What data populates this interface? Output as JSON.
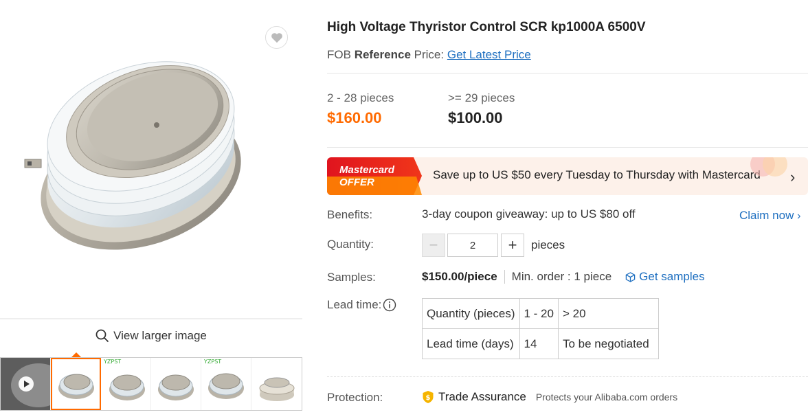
{
  "product": {
    "title": "High Voltage Thyristor Control SCR kp1000A 6500V",
    "fob_prefix": "FOB",
    "fob_bold": "Reference",
    "fob_suffix": "Price:",
    "fob_link": "Get Latest Price"
  },
  "gallery": {
    "view_larger": "View larger image",
    "thumb_tag": "YZPST",
    "thumbnails": [
      "video-thumbnail",
      "thyristor-front",
      "thyristor-side",
      "thyristor-angle",
      "thyristor-tilted",
      "thyristor-ceramic"
    ]
  },
  "pricing": {
    "tiers": [
      {
        "range": "2 - 28 pieces",
        "price": "$160.00"
      },
      {
        "range": ">= 29 pieces",
        "price": "$100.00"
      }
    ]
  },
  "promo": {
    "badge_line1": "Mastercard",
    "badge_line2": "OFFER",
    "text": "Save up to US $50 every Tuesday to Thursday with Mastercard"
  },
  "benefits": {
    "label": "Benefits:",
    "text": "3-day coupon giveaway: up to US $80 off",
    "action": "Claim now"
  },
  "quantity": {
    "label": "Quantity:",
    "value": "2",
    "unit": "pieces"
  },
  "samples": {
    "label": "Samples:",
    "price": "$150.00/piece",
    "min_order": "Min. order : 1 piece",
    "action": "Get samples"
  },
  "lead_time": {
    "label": "Lead time:",
    "rows": [
      [
        "Quantity (pieces)",
        "1 - 20",
        "> 20"
      ],
      [
        "Lead time (days)",
        "14",
        "To be negotiated"
      ]
    ]
  },
  "protection": {
    "label": "Protection:",
    "title": "Trade Assurance",
    "note": "Protects your Alibaba.com orders"
  },
  "colors": {
    "accent_orange": "#ff6a00",
    "link_blue": "#1e6fc0",
    "badge_red": "#e0141e"
  }
}
